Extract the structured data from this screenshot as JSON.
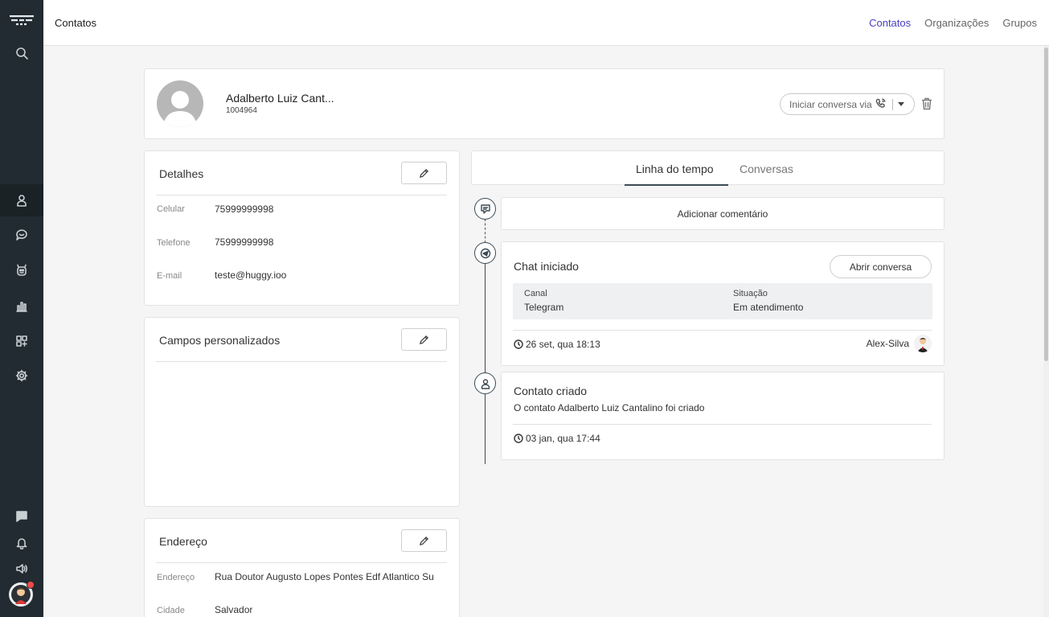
{
  "topbar": {
    "title": "Contatos",
    "nav": [
      "Contatos",
      "Organizações",
      "Grupos"
    ]
  },
  "profile": {
    "name": "Adalberto Luiz Cant...",
    "id": "1004964",
    "start_conversation": "Iniciar conversa via"
  },
  "details": {
    "title": "Detalhes",
    "fields": [
      {
        "label": "Celular",
        "value": "75999999998"
      },
      {
        "label": "Telefone",
        "value": "75999999998"
      },
      {
        "label": "E-mail",
        "value": "teste@huggy.ioo"
      }
    ]
  },
  "custom_fields": {
    "title": "Campos personalizados"
  },
  "address": {
    "title": "Endereço",
    "fields": [
      {
        "label": "Endereço",
        "value": "Rua Doutor Augusto Lopes Pontes  Edf Atlantico Su"
      },
      {
        "label": "Cidade",
        "value": "Salvador"
      }
    ]
  },
  "tabs": [
    "Linha do tempo",
    "Conversas"
  ],
  "timeline": {
    "add_comment": "Adicionar comentário",
    "chat": {
      "title": "Chat iniciado",
      "open_button": "Abrir conversa",
      "channel_label": "Canal",
      "channel_value": "Telegram",
      "status_label": "Situação",
      "status_value": "Em atendimento",
      "time": "26 set, qua 18:13",
      "agent": "Alex-Silva"
    },
    "created": {
      "title": "Contato criado",
      "description": "O contato Adalberto Luiz Cantalino foi criado",
      "time": "03 jan, qua 17:44"
    }
  },
  "colors": {
    "sidebar": "#222b31",
    "accent": "#4a3fbf",
    "notification_badge": "#f04a4a"
  }
}
